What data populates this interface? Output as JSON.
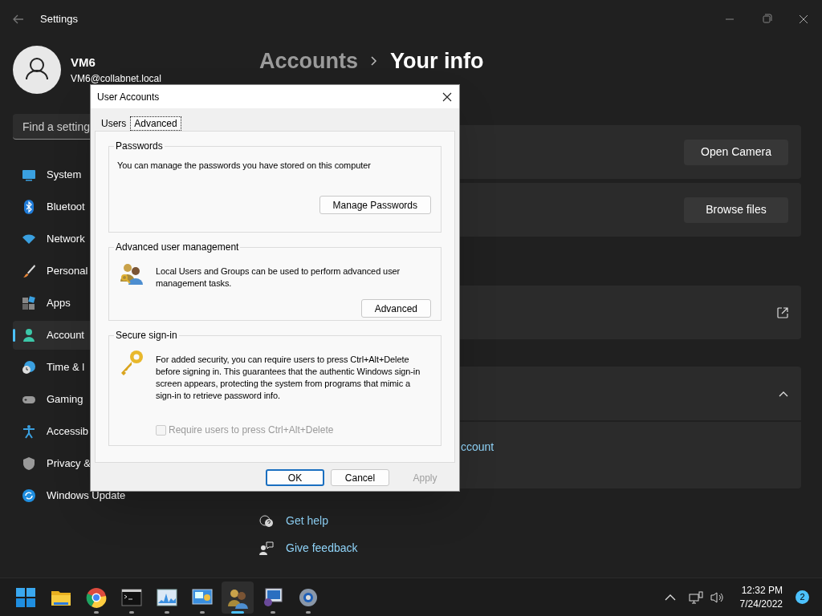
{
  "settings": {
    "title": "Settings",
    "user": {
      "name": "VM6",
      "email": "VM6@collabnet.local"
    },
    "search": {
      "placeholder": "Find a setting"
    },
    "nav": [
      {
        "label": "System",
        "selected": false
      },
      {
        "label": "Bluetoot",
        "selected": false
      },
      {
        "label": "Network",
        "selected": false
      },
      {
        "label": "Personal",
        "selected": false
      },
      {
        "label": "Apps",
        "selected": false
      },
      {
        "label": "Account",
        "selected": true
      },
      {
        "label": "Time & l",
        "selected": false
      },
      {
        "label": "Gaming",
        "selected": false
      },
      {
        "label": "Accessib",
        "selected": false
      },
      {
        "label": "Privacy &",
        "selected": false
      },
      {
        "label": "Windows Update",
        "selected": false
      }
    ],
    "breadcrumb": {
      "parent": "Accounts",
      "current": "Your info"
    },
    "cards": [
      {
        "kind": "button",
        "button": "Open Camera"
      },
      {
        "kind": "button",
        "button": "Browse files"
      },
      {
        "kind": "external"
      },
      {
        "kind": "expander",
        "expanded": true,
        "link": "ccount"
      }
    ],
    "help_links": [
      {
        "label": "Get help"
      },
      {
        "label": "Give feedback"
      }
    ]
  },
  "dialog": {
    "title": "User Accounts",
    "tabs": [
      {
        "label": "Users",
        "selected": false
      },
      {
        "label": "Advanced",
        "selected": true
      }
    ],
    "groups": [
      {
        "title": "Passwords",
        "kind": "plain",
        "text": "You can manage the passwords you have stored on this computer",
        "button": "Manage Passwords"
      },
      {
        "title": "Advanced user management",
        "kind": "users",
        "text": "Local Users and Groups can be used to perform advanced user management tasks.",
        "button": "Advanced"
      },
      {
        "title": "Secure sign-in",
        "kind": "key",
        "text": "For added security, you can require users to press Ctrl+Alt+Delete before signing in. This guarantees that the authentic Windows sign-in screen appears, protecting the system from programs that mimic a sign-in to retrieve password info.",
        "checkbox": {
          "label": "Require users to press Ctrl+Alt+Delete",
          "checked": false,
          "disabled": true
        }
      }
    ],
    "buttons": [
      {
        "label": "OK",
        "default": true,
        "disabled": false
      },
      {
        "label": "Cancel",
        "default": false,
        "disabled": false
      },
      {
        "label": "Apply",
        "default": false,
        "disabled": true
      }
    ]
  },
  "taskbar": {
    "apps": [
      {
        "running": false,
        "selected": false
      },
      {
        "running": false,
        "selected": false
      },
      {
        "running": true,
        "selected": false
      },
      {
        "running": true,
        "selected": false
      },
      {
        "running": true,
        "selected": false
      },
      {
        "running": true,
        "selected": false
      },
      {
        "running": true,
        "selected": true
      },
      {
        "running": true,
        "selected": false
      },
      {
        "running": true,
        "selected": false
      }
    ],
    "time": "12:32 PM",
    "date": "7/24/2022",
    "notifications": "2"
  }
}
